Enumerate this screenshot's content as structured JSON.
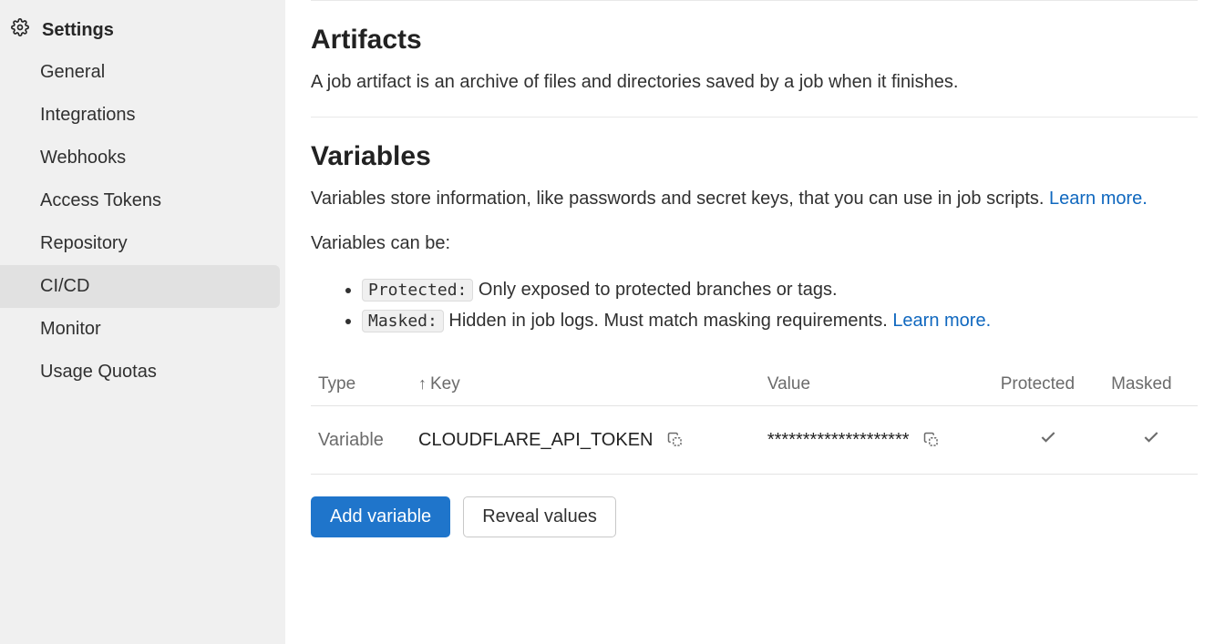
{
  "sidebar": {
    "heading": "Settings",
    "items": [
      {
        "label": "General"
      },
      {
        "label": "Integrations"
      },
      {
        "label": "Webhooks"
      },
      {
        "label": "Access Tokens"
      },
      {
        "label": "Repository"
      },
      {
        "label": "CI/CD"
      },
      {
        "label": "Monitor"
      },
      {
        "label": "Usage Quotas"
      }
    ],
    "active_index": 5
  },
  "artifacts": {
    "title": "Artifacts",
    "description": "A job artifact is an archive of files and directories saved by a job when it finishes."
  },
  "variables": {
    "title": "Variables",
    "description_pre": "Variables store information, like passwords and secret keys, that you can use in job scripts. ",
    "description_link": "Learn more.",
    "can_be_label": "Variables can be:",
    "bullets": {
      "protected": {
        "pill": "Protected:",
        "text": " Only exposed to protected branches or tags."
      },
      "masked": {
        "pill": "Masked:",
        "text": " Hidden in job logs. Must match masking requirements. ",
        "link": "Learn more."
      }
    },
    "table": {
      "headers": {
        "type": "Type",
        "key": "Key",
        "value": "Value",
        "protected": "Protected",
        "masked": "Masked"
      },
      "rows": [
        {
          "type": "Variable",
          "key": "CLOUDFLARE_API_TOKEN",
          "value": "********************",
          "protected": true,
          "masked": true
        }
      ]
    },
    "buttons": {
      "add": "Add variable",
      "reveal": "Reveal values"
    }
  }
}
